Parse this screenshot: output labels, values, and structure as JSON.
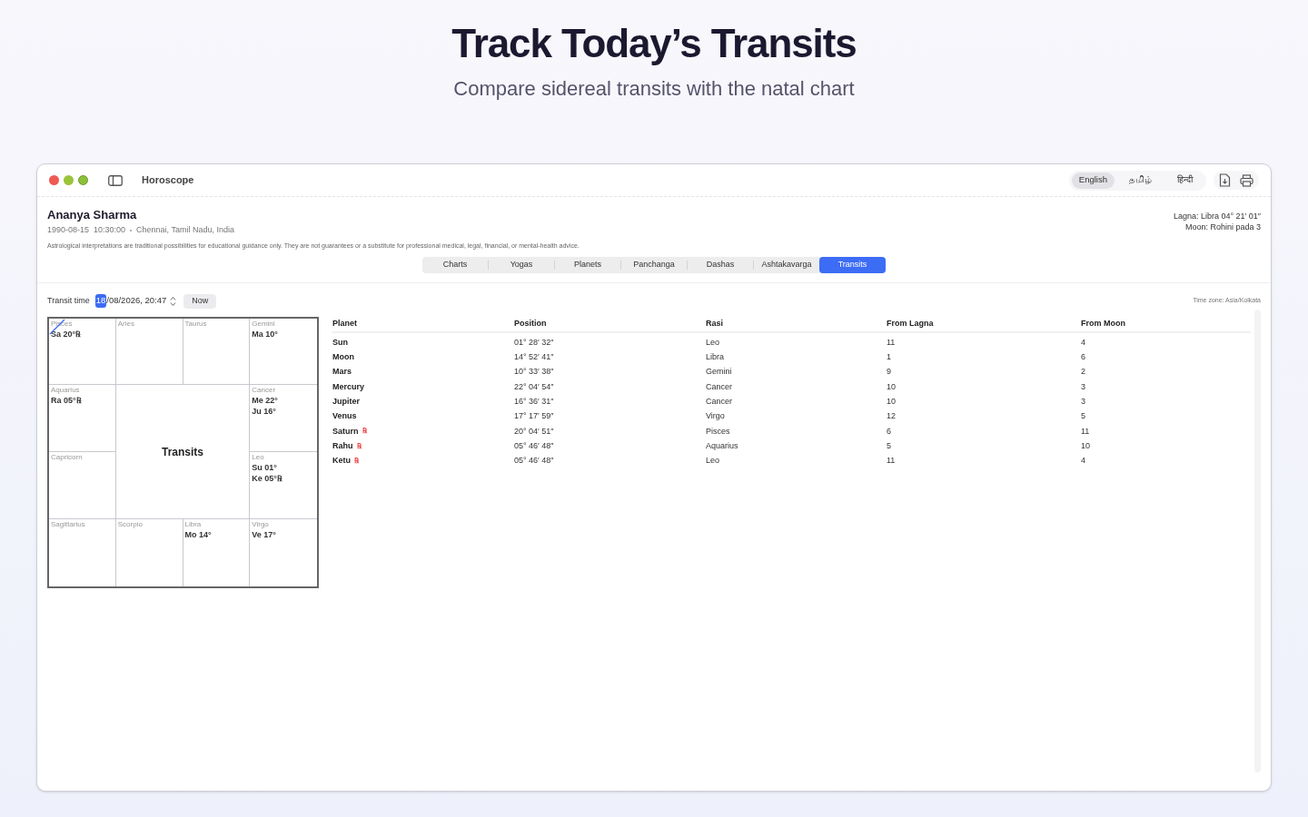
{
  "headline": {
    "title": "Track Today’s Transits",
    "subtitle": "Compare sidereal transits with the natal chart"
  },
  "window": {
    "title": "Horoscope",
    "languages": [
      {
        "label": "English",
        "selected": true
      },
      {
        "label": "தமிழ்",
        "selected": false
      },
      {
        "label": "हिन्दी",
        "selected": false
      }
    ]
  },
  "profile": {
    "name": "Ananya Sharma",
    "birth": "1990-08-15  10:30:00",
    "place": "Chennai, Tamil Nadu, India",
    "disclaimer": "Astrological interpretations are traditional possibilities for educational guidance only. They are not guarantees or a substitute for professional medical, legal, financial, or mental-health advice.",
    "lagna": "Lagna: Libra 04° 21′ 01″",
    "moon": "Moon: Rohini pada 3"
  },
  "tabs": [
    {
      "label": "Charts",
      "selected": false
    },
    {
      "label": "Yogas",
      "selected": false
    },
    {
      "label": "Planets",
      "selected": false
    },
    {
      "label": "Panchanga",
      "selected": false
    },
    {
      "label": "Dashas",
      "selected": false
    },
    {
      "label": "Ashtakavarga",
      "selected": false
    },
    {
      "label": "Transits",
      "selected": true
    }
  ],
  "transit_time": {
    "label": "Transit time",
    "day": "18",
    "rest": "/08/2026, 20:47",
    "now_button": "Now",
    "timezone": "Time zone: Asia/Kolkata"
  },
  "chart": {
    "title": "Transits",
    "houses": [
      {
        "sign": "Pisces",
        "marked": true,
        "planets": [
          "Sa 20°℞"
        ]
      },
      {
        "sign": "Aries",
        "marked": false
      },
      {
        "sign": "Taurus",
        "marked": false
      },
      {
        "sign": "Gemini",
        "marked": false,
        "planets": [
          "Ma 10°"
        ]
      },
      {
        "sign": "Aquarius",
        "marked": false,
        "planets": [
          "Ra 05°℞"
        ]
      },
      {
        "sign": "Cancer",
        "marked": false,
        "planets": [
          "Me 22°",
          "Ju 16°"
        ]
      },
      {
        "sign": "Capricorn",
        "marked": false
      },
      {
        "sign": "Leo",
        "marked": false,
        "planets": [
          "Su 01°",
          "Ke 05°℞"
        ]
      },
      {
        "sign": "Sagittarius",
        "marked": false
      },
      {
        "sign": "Scorpio",
        "marked": false
      },
      {
        "sign": "Libra",
        "marked": false,
        "planets": [
          "Mo 14°"
        ]
      },
      {
        "sign": "Virgo",
        "marked": false,
        "planets": [
          "Ve 17°"
        ]
      }
    ]
  },
  "table": {
    "columns": [
      "Planet",
      "Position",
      "Rasi",
      "From Lagna",
      "From Moon"
    ],
    "rows": [
      {
        "planet": "Sun",
        "position": "01° 28′ 32″",
        "rasi": "Leo",
        "from_lagna": "11",
        "from_moon": "4"
      },
      {
        "planet": "Moon",
        "position": "14° 52′ 41″",
        "rasi": "Libra",
        "from_lagna": "1",
        "from_moon": "6"
      },
      {
        "planet": "Mars",
        "position": "10° 33′ 38″",
        "rasi": "Gemini",
        "from_lagna": "9",
        "from_moon": "2"
      },
      {
        "planet": "Mercury",
        "position": "22° 04′ 54″",
        "rasi": "Cancer",
        "from_lagna": "10",
        "from_moon": "3"
      },
      {
        "planet": "Jupiter",
        "position": "16° 36′ 31″",
        "rasi": "Cancer",
        "from_lagna": "10",
        "from_moon": "3"
      },
      {
        "planet": "Venus",
        "position": "17° 17′ 59″",
        "rasi": "Virgo",
        "from_lagna": "12",
        "from_moon": "5"
      },
      {
        "planet": "Saturn",
        "retro_mark": "℞",
        "position": "20° 04′ 51″",
        "rasi": "Pisces",
        "from_lagna": "6",
        "from_moon": "11"
      },
      {
        "planet": "Rahu",
        "retro_mark": "℞",
        "position": "05° 46′ 48″",
        "rasi": "Aquarius",
        "from_lagna": "5",
        "from_moon": "10"
      },
      {
        "planet": "Ketu",
        "retro_mark": "℞",
        "position": "05° 46′ 48″",
        "rasi": "Leo",
        "from_lagna": "11",
        "from_moon": "4"
      }
    ]
  }
}
